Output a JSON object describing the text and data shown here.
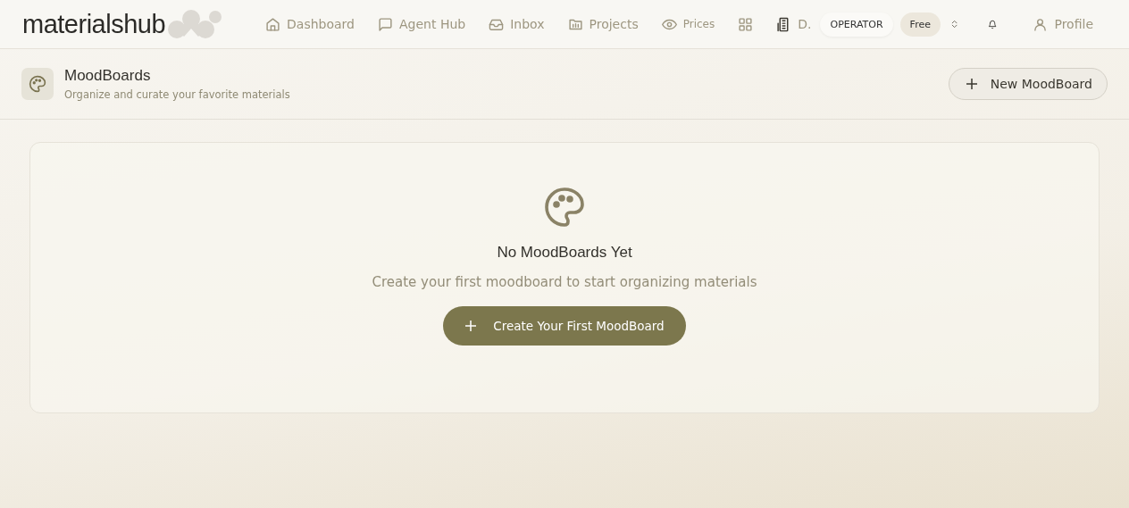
{
  "brand": {
    "name": "materialshub"
  },
  "nav": [
    {
      "kind": "home",
      "label": "Dashboard"
    },
    {
      "kind": "chat",
      "label": "Agent Hub"
    },
    {
      "kind": "inbox",
      "label": "Inbox"
    },
    {
      "kind": "folder",
      "label": "Projects"
    },
    {
      "kind": "eye",
      "label": "Prices"
    },
    {
      "kind": "grid"
    },
    {
      "kind": "building",
      "label": "D."
    }
  ],
  "role_badge": "OPERATOR",
  "plan_badge": "Free",
  "profile": {
    "label": "Profile"
  },
  "header": {
    "title": "MoodBoards",
    "subtitle": "Organize and curate your favorite materials",
    "button": "New MoodBoard"
  },
  "empty": {
    "title": "No MoodBoards Yet",
    "message": "Create your first moodboard to start organizing materials",
    "button": "Create Your First MoodBoard"
  }
}
